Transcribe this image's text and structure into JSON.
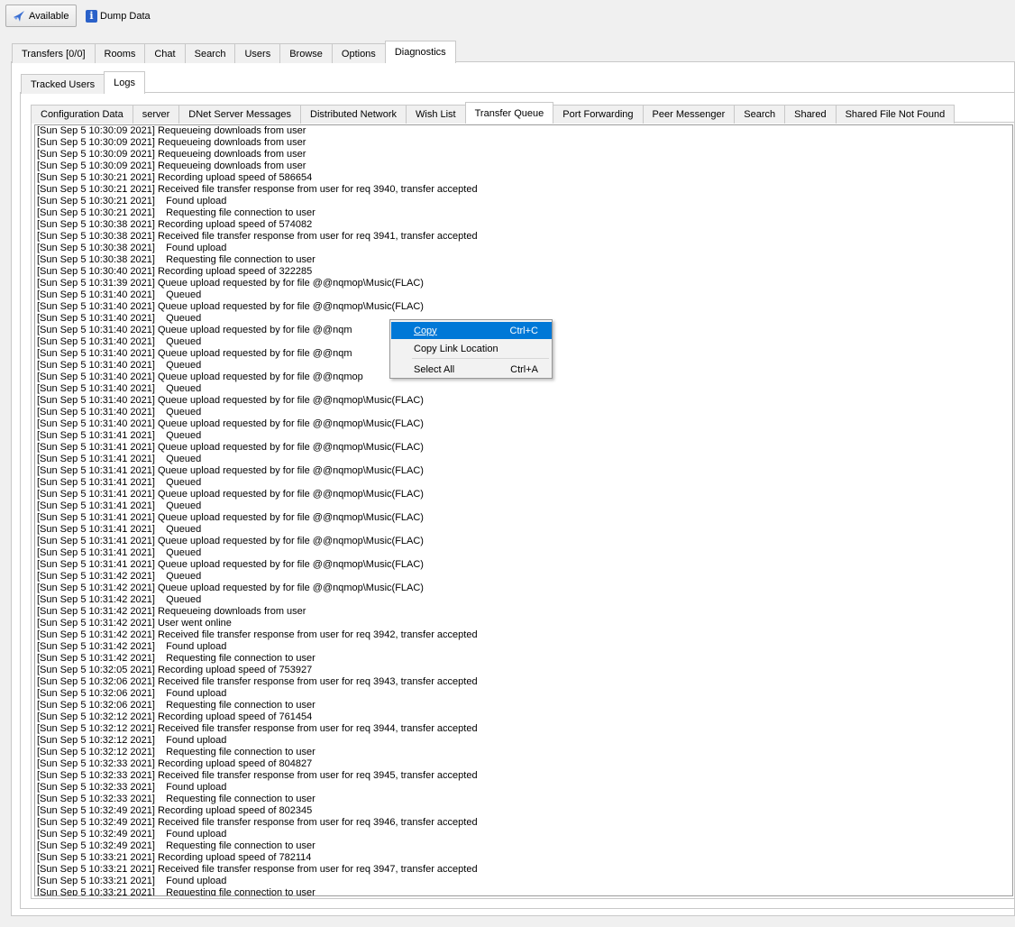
{
  "toolbar": {
    "available_label": "Available",
    "dump_label": "Dump Data"
  },
  "main_tabs": [
    "Transfers [0/0]",
    "Rooms",
    "Chat",
    "Search",
    "Users",
    "Browse",
    "Options",
    "Diagnostics"
  ],
  "main_active": "Diagnostics",
  "sub_tabs": [
    "Tracked Users",
    "Logs"
  ],
  "sub_active": "Logs",
  "log_tabs": [
    "Configuration Data",
    "server",
    "DNet Server Messages",
    "Distributed Network",
    "Wish List",
    "Transfer Queue",
    "Port Forwarding",
    "Peer Messenger",
    "Search",
    "Shared",
    "Shared File Not Found"
  ],
  "log_active": "Transfer Queue",
  "log_lines": [
    "[Sun Sep 5 10:30:09 2021] Requeueing downloads from user",
    "[Sun Sep 5 10:30:09 2021] Requeueing downloads from user",
    "[Sun Sep 5 10:30:09 2021] Requeueing downloads from user",
    "[Sun Sep 5 10:30:09 2021] Requeueing downloads from user",
    "[Sun Sep 5 10:30:21 2021] Recording upload speed of 586654",
    "[Sun Sep 5 10:30:21 2021] Received file transfer response from user for req 3940, transfer accepted",
    "[Sun Sep 5 10:30:21 2021]    Found upload",
    "[Sun Sep 5 10:30:21 2021]    Requesting file connection to user",
    "[Sun Sep 5 10:30:38 2021] Recording upload speed of 574082",
    "[Sun Sep 5 10:30:38 2021] Received file transfer response from user for req 3941, transfer accepted",
    "[Sun Sep 5 10:30:38 2021]    Found upload",
    "[Sun Sep 5 10:30:38 2021]    Requesting file connection to user",
    "[Sun Sep 5 10:30:40 2021] Recording upload speed of 322285",
    "[Sun Sep 5 10:31:39 2021] Queue upload requested by for file @@nqmop\\Music(FLAC)",
    "[Sun Sep 5 10:31:40 2021]    Queued",
    "[Sun Sep 5 10:31:40 2021] Queue upload requested by for file @@nqmop\\Music(FLAC)",
    "[Sun Sep 5 10:31:40 2021]    Queued",
    "[Sun Sep 5 10:31:40 2021] Queue upload requested by for file @@nqm",
    "[Sun Sep 5 10:31:40 2021]    Queued",
    "[Sun Sep 5 10:31:40 2021] Queue upload requested by for file @@nqm",
    "[Sun Sep 5 10:31:40 2021]    Queued",
    "[Sun Sep 5 10:31:40 2021] Queue upload requested by for file @@nqmop",
    "[Sun Sep 5 10:31:40 2021]    Queued",
    "[Sun Sep 5 10:31:40 2021] Queue upload requested by for file @@nqmop\\Music(FLAC)",
    "[Sun Sep 5 10:31:40 2021]    Queued",
    "[Sun Sep 5 10:31:40 2021] Queue upload requested by for file @@nqmop\\Music(FLAC)",
    "[Sun Sep 5 10:31:41 2021]    Queued",
    "[Sun Sep 5 10:31:41 2021] Queue upload requested by for file @@nqmop\\Music(FLAC)",
    "[Sun Sep 5 10:31:41 2021]    Queued",
    "[Sun Sep 5 10:31:41 2021] Queue upload requested by for file @@nqmop\\Music(FLAC)",
    "[Sun Sep 5 10:31:41 2021]    Queued",
    "[Sun Sep 5 10:31:41 2021] Queue upload requested by for file @@nqmop\\Music(FLAC)",
    "[Sun Sep 5 10:31:41 2021]    Queued",
    "[Sun Sep 5 10:31:41 2021] Queue upload requested by for file @@nqmop\\Music(FLAC)",
    "[Sun Sep 5 10:31:41 2021]    Queued",
    "[Sun Sep 5 10:31:41 2021] Queue upload requested by for file @@nqmop\\Music(FLAC)",
    "[Sun Sep 5 10:31:41 2021]    Queued",
    "[Sun Sep 5 10:31:41 2021] Queue upload requested by for file @@nqmop\\Music(FLAC)",
    "[Sun Sep 5 10:31:42 2021]    Queued",
    "[Sun Sep 5 10:31:42 2021] Queue upload requested by for file @@nqmop\\Music(FLAC)",
    "[Sun Sep 5 10:31:42 2021]    Queued",
    "[Sun Sep 5 10:31:42 2021] Requeueing downloads from user",
    "[Sun Sep 5 10:31:42 2021] User went online",
    "[Sun Sep 5 10:31:42 2021] Received file transfer response from user for req 3942, transfer accepted",
    "[Sun Sep 5 10:31:42 2021]    Found upload",
    "[Sun Sep 5 10:31:42 2021]    Requesting file connection to user",
    "[Sun Sep 5 10:32:05 2021] Recording upload speed of 753927",
    "[Sun Sep 5 10:32:06 2021] Received file transfer response from user for req 3943, transfer accepted",
    "[Sun Sep 5 10:32:06 2021]    Found upload",
    "[Sun Sep 5 10:32:06 2021]    Requesting file connection to user",
    "[Sun Sep 5 10:32:12 2021] Recording upload speed of 761454",
    "[Sun Sep 5 10:32:12 2021] Received file transfer response from user for req 3944, transfer accepted",
    "[Sun Sep 5 10:32:12 2021]    Found upload",
    "[Sun Sep 5 10:32:12 2021]    Requesting file connection to user",
    "[Sun Sep 5 10:32:33 2021] Recording upload speed of 804827",
    "[Sun Sep 5 10:32:33 2021] Received file transfer response from user for req 3945, transfer accepted",
    "[Sun Sep 5 10:32:33 2021]    Found upload",
    "[Sun Sep 5 10:32:33 2021]    Requesting file connection to user",
    "[Sun Sep 5 10:32:49 2021] Recording upload speed of 802345",
    "[Sun Sep 5 10:32:49 2021] Received file transfer response from user for req 3946, transfer accepted",
    "[Sun Sep 5 10:32:49 2021]    Found upload",
    "[Sun Sep 5 10:32:49 2021]    Requesting file connection to user",
    "[Sun Sep 5 10:33:21 2021] Recording upload speed of 782114",
    "[Sun Sep 5 10:33:21 2021] Received file transfer response from user for req 3947, transfer accepted",
    "[Sun Sep 5 10:33:21 2021]    Found upload",
    "[Sun Sep 5 10:33:21 2021]    Requesting file connection to user"
  ],
  "context_menu": {
    "items": [
      {
        "label": "Copy",
        "shortcut": "Ctrl+C"
      },
      {
        "label": "Copy Link Location",
        "shortcut": ""
      },
      {
        "label": "Select All",
        "shortcut": "Ctrl+A"
      }
    ]
  },
  "colors": {
    "highlight": "#0078d7",
    "tab_border": "#c8c8c8",
    "background": "#f0f0f0"
  },
  "icons": {
    "available": "bird-icon",
    "dump": "info-icon"
  }
}
